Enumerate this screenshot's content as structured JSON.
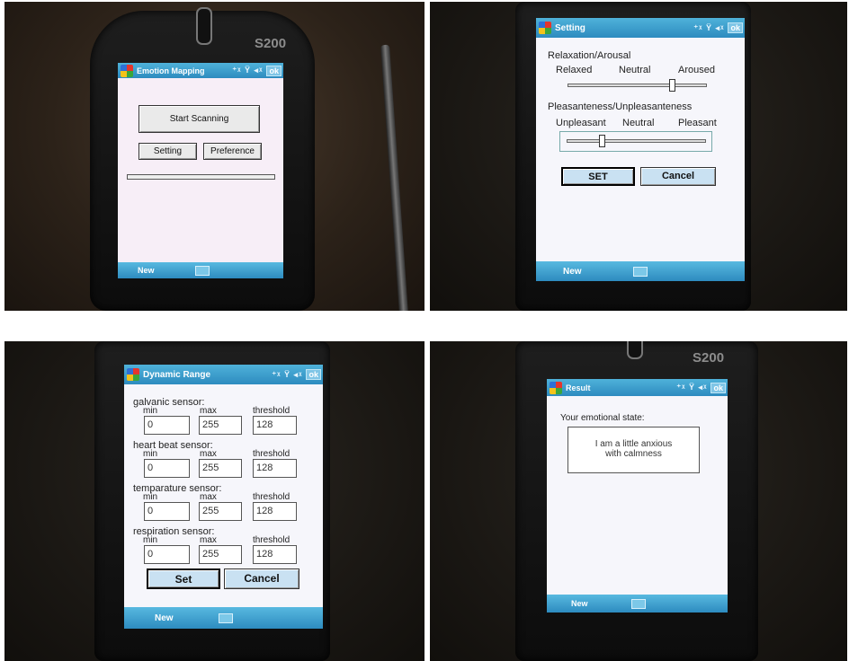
{
  "brand": "S200",
  "panel1": {
    "title": "Emotion Mapping",
    "status_icons": "⁺ᵡ Ÿ ◂ᵡ",
    "ok": "ok",
    "start_scanning": "Start Scanning",
    "setting": "Setting",
    "preference": "Preference",
    "softkey_left": "New"
  },
  "panel2": {
    "title": "Setting",
    "status_icons": "⁺ᵡ Ÿ ◂ᵡ",
    "ok": "ok",
    "group1_label": "Relaxation/Arousal",
    "group1_low": "Relaxed",
    "group1_mid": "Neutral",
    "group1_high": "Aroused",
    "group1_level": 0.75,
    "group2_label": "Pleasanteness/Unpleasanteness",
    "group2_low": "Unpleasant",
    "group2_mid": "Neutral",
    "group2_high": "Pleasant",
    "group2_level": 0.25,
    "set": "SET",
    "cancel": "Cancel",
    "softkey_left": "New"
  },
  "panel3": {
    "title": "Dynamic Range",
    "status_icons": "⁺ᵡ Ÿ ◂ᵡ",
    "ok": "ok",
    "col_min": "min",
    "col_max": "max",
    "col_threshold": "threshold",
    "sensors": [
      {
        "name": "galvanic sensor:",
        "min": "0",
        "max": "255",
        "threshold": "128"
      },
      {
        "name": "heart beat sensor:",
        "min": "0",
        "max": "255",
        "threshold": "128"
      },
      {
        "name": "temparature sensor:",
        "min": "0",
        "max": "255",
        "threshold": "128"
      },
      {
        "name": "respiration sensor:",
        "min": "0",
        "max": "255",
        "threshold": "128"
      }
    ],
    "set": "Set",
    "cancel": "Cancel",
    "softkey_left": "New"
  },
  "panel4": {
    "title": "Result",
    "status_icons": "⁺ᵡ Ÿ ◂ᵡ",
    "ok": "ok",
    "label": "Your emotional state:",
    "result_line1": "I am a little anxious",
    "result_line2": "with calmness",
    "softkey_left": "New"
  }
}
